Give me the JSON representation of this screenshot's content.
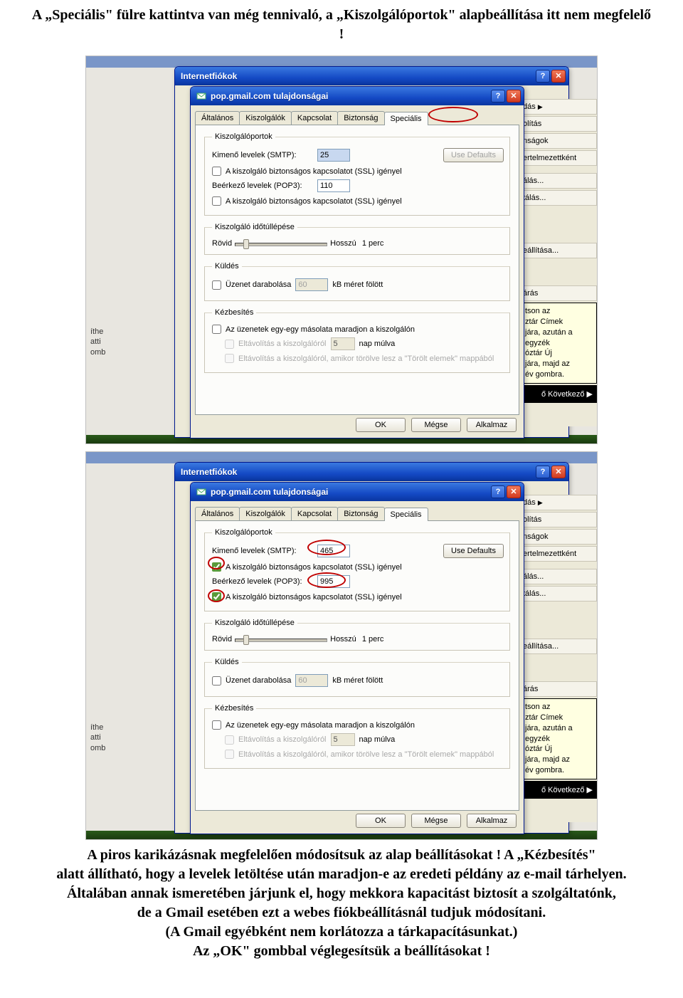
{
  "caption1": "A „Speciális\" fülre kattintva van még tennivaló, a „Kiszolgálóportok\" alapbeállítása itt nem megfelelő !",
  "caption2_lines": [
    "A piros karikázásnak megfelelően módosítsuk az alap beállításokat ! A „Kézbesítés\"",
    "alatt állítható, hogy a levelek letöltése után maradjon-e az eredeti példány az e-mail tárhelyen.",
    "Általában annak ismeretében járjunk el, hogy mekkora kapacitást biztosít a szolgáltatónk,",
    "de a Gmail esetében ezt a webes fiókbeállításnál tudjuk módosítani.",
    "(A Gmail egyébként nem korlátozza a tárkapacításunkat.)",
    "Az „OK\" gombbal véglegesítsük a beállításokat !"
  ],
  "outer_title": "Internetfiókok",
  "inner_title": "pop.gmail.com tulajdonságai",
  "tabs": {
    "t0": "Általános",
    "t1": "Kiszolgálók",
    "t2": "Kapcsolat",
    "t3": "Biztonság",
    "t4": "Speciális"
  },
  "grp": {
    "ports": "Kiszolgálóportok",
    "timeout": "Kiszolgáló időtúllépése",
    "send": "Küldés",
    "deliv": "Kézbesítés"
  },
  "labels": {
    "smtp": "Kimenő levelek (SMTP):",
    "use_defaults": "Use Defaults",
    "ssl_out": "A kiszolgáló biztonságos kapcsolatot (SSL) igényel",
    "pop3": "Beérkező levelek (POP3):",
    "ssl_in": "A kiszolgáló biztonságos kapcsolatot (SSL) igényel",
    "short": "Rövid",
    "long": "Hosszú",
    "one_min": "1 perc",
    "split": "Üzenet darabolása",
    "kb_above": "kB méret fölött",
    "leave_copy": "Az üzenetek egy-egy másolata maradjon a kiszolgálón",
    "remove_after": "Eltávolítás a kiszolgálóról",
    "days_after": "nap múlva",
    "remove_deleted": "Eltávolítás a kiszolgálóról, amikor törölve lesz a \"Törölt elemek\" mappából"
  },
  "buttons": {
    "ok": "OK",
    "cancel": "Mégse",
    "apply": "Alkalmaz"
  },
  "values_before": {
    "smtp": "25",
    "pop3": "110",
    "split": "60",
    "days": "5",
    "ssl_out": false,
    "ssl_in": false
  },
  "values_after": {
    "smtp": "465",
    "pop3": "995",
    "split": "60",
    "days": "5",
    "ssl_out": true,
    "ssl_in": true
  },
  "rmenu": {
    "i0": "dás",
    "i1": "olítás",
    "i2": "nságok",
    "i3": "ertelmezettként",
    "i4": "álás...",
    "i5": "tálás...",
    "i6": "eállítása...",
    "i7": "árás",
    "tip": "tson az\nztár Címek\njára, azután a\negyzék\nóztár Új\njára, majd az\név gombra.",
    "nav": "ő  Következő ▶"
  },
  "lfrag": "íthe\natti\nomb"
}
